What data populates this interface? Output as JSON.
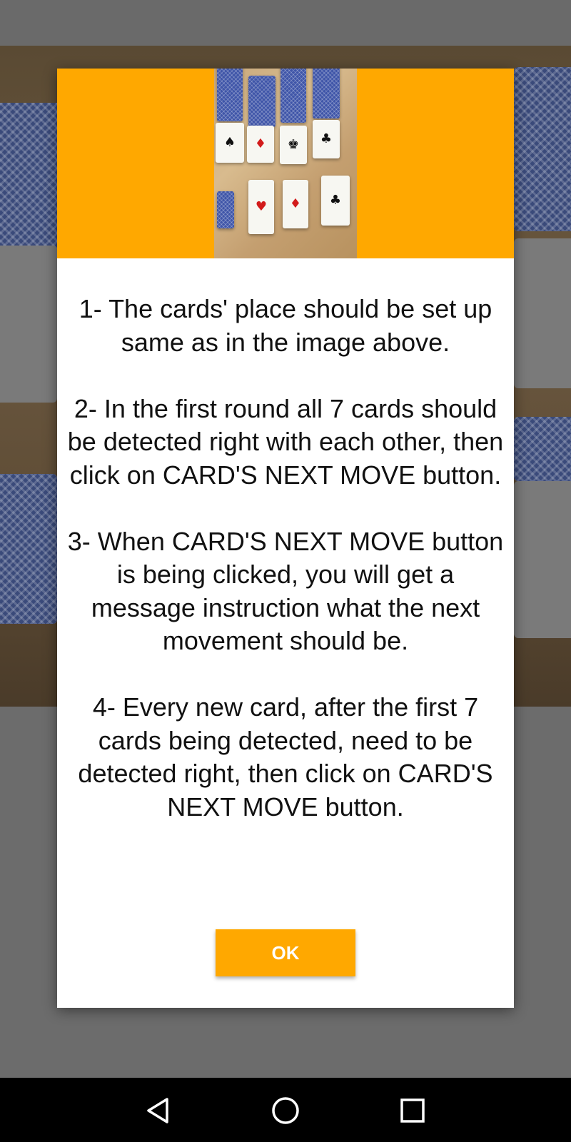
{
  "dialog": {
    "instructions": [
      "1- The cards' place should be set up same as in the image above.",
      "2- In the first round all 7 cards should be detected right with each other, then click on CARD'S NEXT MOVE button.",
      "3- When CARD'S NEXT MOVE button is being clicked, you will get a message instruction what the next movement should be.",
      "4- Every new card, after the first 7 cards being detected, need to be detected right, then click on CARD'S NEXT MOVE button."
    ],
    "ok_label": "OK",
    "accent_color": "#ffa800"
  },
  "nav_bar": {
    "icons": [
      "back-icon",
      "home-icon",
      "recents-icon"
    ]
  }
}
